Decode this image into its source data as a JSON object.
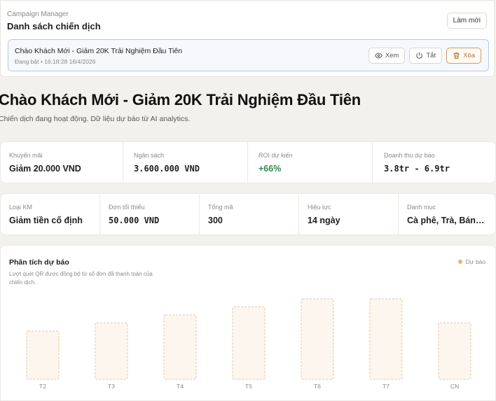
{
  "header": {
    "kicker": "Campaign Manager",
    "title": "Danh sách chiến dịch",
    "refresh_label": "Làm mới"
  },
  "campaign_row": {
    "name": "Chào Khách Mới - Giảm 20K Trải Nghiệm Đầu Tiên",
    "status": "Đang bật • 16:18:28 16/4/2026",
    "actions": {
      "view": "Xem",
      "toggle": "Tắt",
      "delete": "Xóa"
    }
  },
  "hero": {
    "title": "Chào Khách Mới - Giảm 20K Trải Nghiệm Đầu Tiên",
    "subtitle": "Chiến dịch đang hoạt động. Dữ liệu dự báo từ AI analytics."
  },
  "stats_row1": [
    {
      "label": "Khuyến mãi",
      "value": "Giảm 20.000 VND",
      "style": "bold"
    },
    {
      "label": "Ngân sách",
      "value": "3.600.000 VND",
      "style": "mono"
    },
    {
      "label": "ROI dự kiến",
      "value": "+66%",
      "style": "green"
    },
    {
      "label": "Doanh thu dự báo",
      "value": "3.8tr - 6.9tr",
      "style": "mono"
    }
  ],
  "stats_row2": [
    {
      "label": "Loại KM",
      "value": "Giảm tiền cố định",
      "style": "bold"
    },
    {
      "label": "Đơn tối thiểu",
      "value": "50.000 VND",
      "style": "mono"
    },
    {
      "label": "Tổng mã",
      "value": "300",
      "style": "bold"
    },
    {
      "label": "Hiệu lực",
      "value": "14 ngày",
      "style": "bold"
    },
    {
      "label": "Danh mục",
      "value": "Cà phê, Trà, Bánh ...",
      "style": "bold"
    }
  ],
  "chart_panel": {
    "title": "Phân tích dự báo",
    "description": "Lượt quét QR được đồng bộ từ số đơn đã thanh toán của chiến dịch.",
    "legend_label": "Dự báo",
    "legend_color": "#e7b75c"
  },
  "chart_data": {
    "type": "bar",
    "categories": [
      "T2",
      "T3",
      "T4",
      "T5",
      "T6",
      "T7",
      "CN"
    ],
    "series": [
      {
        "name": "Dự báo",
        "values": [
          0.6,
          0.7,
          0.8,
          0.9,
          1.0,
          1.0,
          0.7
        ]
      }
    ],
    "title": "Phân tích dự báo",
    "ylim": [
      0,
      1
    ],
    "grid": false,
    "legend": "top-right",
    "bar_fill": "#fcf6ee",
    "bar_stroke": "#e2c9a6"
  },
  "colors": {
    "accent_green": "#2e8b4e",
    "danger": "#b0733a",
    "row_border": "#b9c9de"
  }
}
